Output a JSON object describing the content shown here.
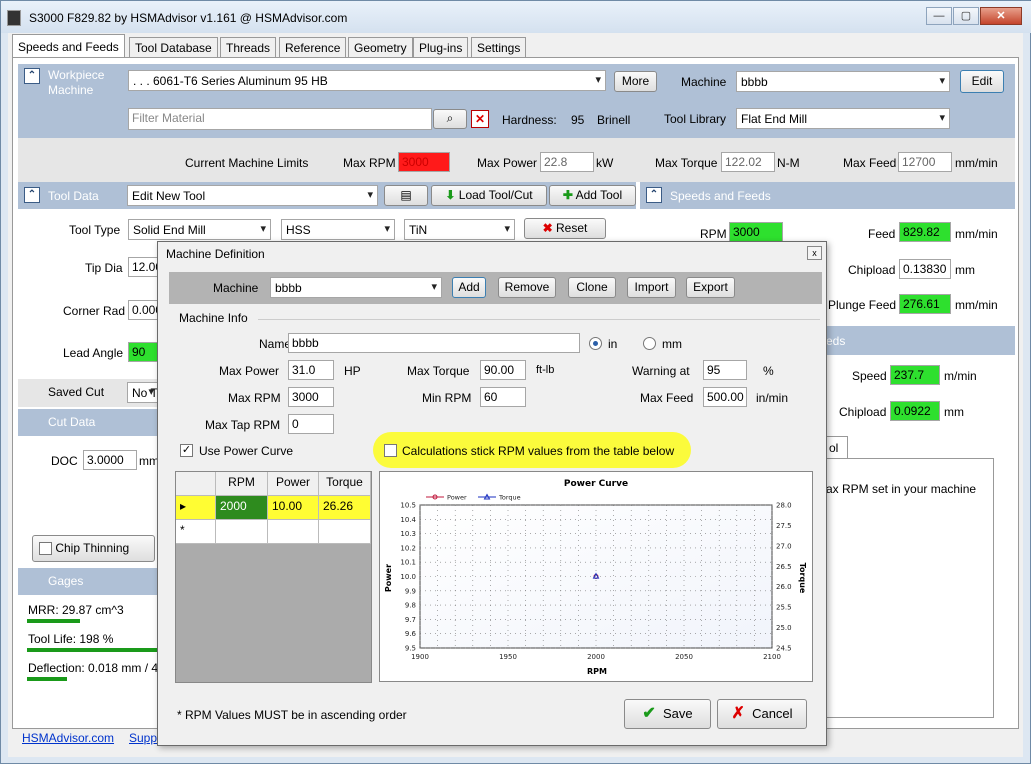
{
  "window": {
    "title": "S3000 F829.82 by HSMAdvisor v1.161 @ HSMAdvisor.com",
    "minimize_glyph": "—",
    "maximize_glyph": "▢",
    "close_glyph": "✕"
  },
  "tabs": [
    "Speeds and Feeds",
    "Tool Database",
    "Threads",
    "Reference",
    "Geometry",
    "Plug-ins",
    "Settings"
  ],
  "workpiece": {
    "section_label": "Workpiece\nMachine",
    "material": ". . . 6061-T6 Series Aluminum 95 HB",
    "more_button": "More",
    "machine_label": "Machine",
    "machine_value": "bbbb",
    "edit_button": "Edit",
    "filter_placeholder": "Filter Material",
    "hardness_label": "Hardness:",
    "hardness_value": "95",
    "hardness_unit": "Brinell",
    "tool_library_label": "Tool Library",
    "tool_library_value": "Flat End Mill"
  },
  "limits": {
    "label": "Current Machine Limits",
    "max_rpm_label": "Max RPM",
    "max_rpm_value": "3000",
    "max_power_label": "Max Power",
    "max_power_value": "22.8",
    "max_power_unit": "kW",
    "max_torque_label": "Max Torque",
    "max_torque_value": "122.02",
    "max_torque_unit": "N-M",
    "max_feed_label": "Max Feed",
    "max_feed_value": "12700",
    "max_feed_unit": "mm/min"
  },
  "tool_data": {
    "section_label": "Tool Data",
    "tool_combo": "Edit New Tool",
    "load_button": "Load Tool/Cut",
    "add_button": "Add Tool",
    "tool_type_label": "Tool Type",
    "tool_type_value": "Solid End Mill",
    "material_value": "HSS",
    "coating_value": "TiN",
    "reset_button": "Reset",
    "tip_dia_label": "Tip Dia",
    "tip_dia_value": "12.00",
    "corner_rad_label": "Corner Rad",
    "corner_rad_value": "0.000",
    "lead_angle_label": "Lead Angle",
    "lead_angle_value": "90"
  },
  "speeds": {
    "section_label": "Speeds and Feeds",
    "rpm_label": "RPM",
    "rpm_value": "3000",
    "feed_label": "Feed",
    "feed_value": "829.82",
    "feed_unit": "mm/min",
    "chipload_label": "Chipload",
    "chipload_value": "0.13830",
    "chipload_unit": "mm",
    "plunge_label": "Plunge Feed",
    "plunge_value": "276.61",
    "plunge_unit": "mm/min",
    "eds_fragment": "eds",
    "speed_label": "Speed",
    "speed_value": "237.7",
    "speed_unit": "m/min",
    "chipload2_label": "Chipload",
    "chipload2_value": "0.0922",
    "chipload2_unit": "mm",
    "tab_fragment": "ol",
    "note_fragment": "ax RPM set in your machine"
  },
  "saved_cut": {
    "label": "Saved Cut",
    "value": "No T"
  },
  "cut_data": {
    "label": "Cut Data",
    "doc_label": "DOC",
    "doc_value": "3.0000",
    "doc_unit": "mm",
    "chip_thinning": "Chip Thinning"
  },
  "gages": {
    "label": "Gages",
    "mrr": "MRR: 29.87 cm^3",
    "tool_life": "Tool Life: 198 %",
    "deflection": "Deflection: 0.018 mm / 4"
  },
  "footer": {
    "link1": "HSMAdvisor.com",
    "link2": "Supp"
  },
  "dialog": {
    "title": "Machine Definition",
    "close_glyph": "x",
    "machine_label": "Machine",
    "machine_value": "bbbb",
    "buttons": [
      "Add",
      "Remove",
      "Clone",
      "Import",
      "Export"
    ],
    "machine_info_label": "Machine Info",
    "name_label": "Name",
    "name_value": "bbbb",
    "unit_in": "in",
    "unit_mm": "mm",
    "max_power_label": "Max Power",
    "max_power_value": "31.0",
    "max_power_unit": "HP",
    "max_torque_label": "Max Torque",
    "max_torque_value": "90.00",
    "max_torque_unit": "ft-lb",
    "warning_label": "Warning at",
    "warning_value": "95",
    "warning_unit": "%",
    "max_rpm_label": "Max RPM",
    "max_rpm_value": "3000",
    "min_rpm_label": "Min RPM",
    "min_rpm_value": "60",
    "max_feed_label": "Max Feed",
    "max_feed_value": "500.00",
    "max_feed_unit": "in/min",
    "max_tap_label": "Max Tap RPM",
    "max_tap_value": "0",
    "use_power_curve": "Use Power Curve",
    "stick_rpm": "Calculations stick RPM values from the table below",
    "grid_headers": [
      "RPM",
      "Power",
      "Torque"
    ],
    "grid_row": [
      "2000",
      "10.00",
      "26.26"
    ],
    "new_row_marker": "*",
    "row_marker": "▸",
    "note": "* RPM Values MUST be in ascending order",
    "save_button": "Save",
    "cancel_button": "Cancel"
  },
  "chart_data": {
    "type": "scatter",
    "title": "Power Curve",
    "xlabel": "RPM",
    "ylabel": "Power",
    "y2label": "Torque",
    "xlim": [
      1900,
      2100
    ],
    "ylim": [
      9.5,
      10.5
    ],
    "y2lim": [
      24.5,
      28.0
    ],
    "xticks": [
      1900,
      1950,
      2000,
      2050,
      2100
    ],
    "yticks": [
      9.5,
      9.6,
      9.7,
      9.8,
      9.9,
      10.0,
      10.1,
      10.2,
      10.3,
      10.4,
      10.5
    ],
    "y2ticks": [
      24.5,
      25.0,
      25.5,
      26.0,
      26.5,
      27.0,
      27.5,
      28.0
    ],
    "grid": true,
    "legend_placement": "top-left",
    "series": [
      {
        "name": "Power",
        "axis": "left",
        "color": "#c0183c",
        "x": [
          2000
        ],
        "y": [
          10.0
        ]
      },
      {
        "name": "Torque",
        "axis": "right",
        "color": "#1a2fc0",
        "x": [
          2000
        ],
        "y": [
          26.26
        ]
      }
    ]
  }
}
